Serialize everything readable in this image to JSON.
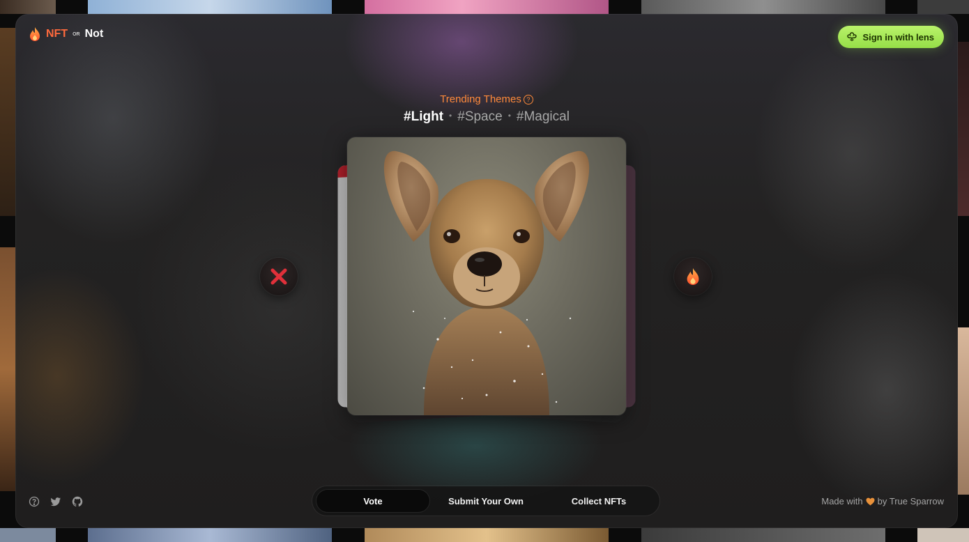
{
  "header": {
    "logo": {
      "nft": "NFT",
      "or": "OR",
      "not": "Not"
    },
    "signin_label": "Sign in with lens"
  },
  "trending": {
    "title": "Trending Themes",
    "tags": [
      "#Light",
      "#Space",
      "#Magical"
    ]
  },
  "tabs": [
    {
      "label": "Vote",
      "active": true
    },
    {
      "label": "Submit Your Own",
      "active": false
    },
    {
      "label": "Collect NFTs",
      "active": false
    }
  ],
  "footer": {
    "made_with_prefix": "Made with",
    "made_with_suffix": "by True Sparrow",
    "icons": [
      "help-icon",
      "twitter-icon",
      "github-icon"
    ]
  },
  "colors": {
    "accent_orange": "#ff6a3d",
    "lens_green": "#a6e85a",
    "nope_red": "#e0303a"
  }
}
